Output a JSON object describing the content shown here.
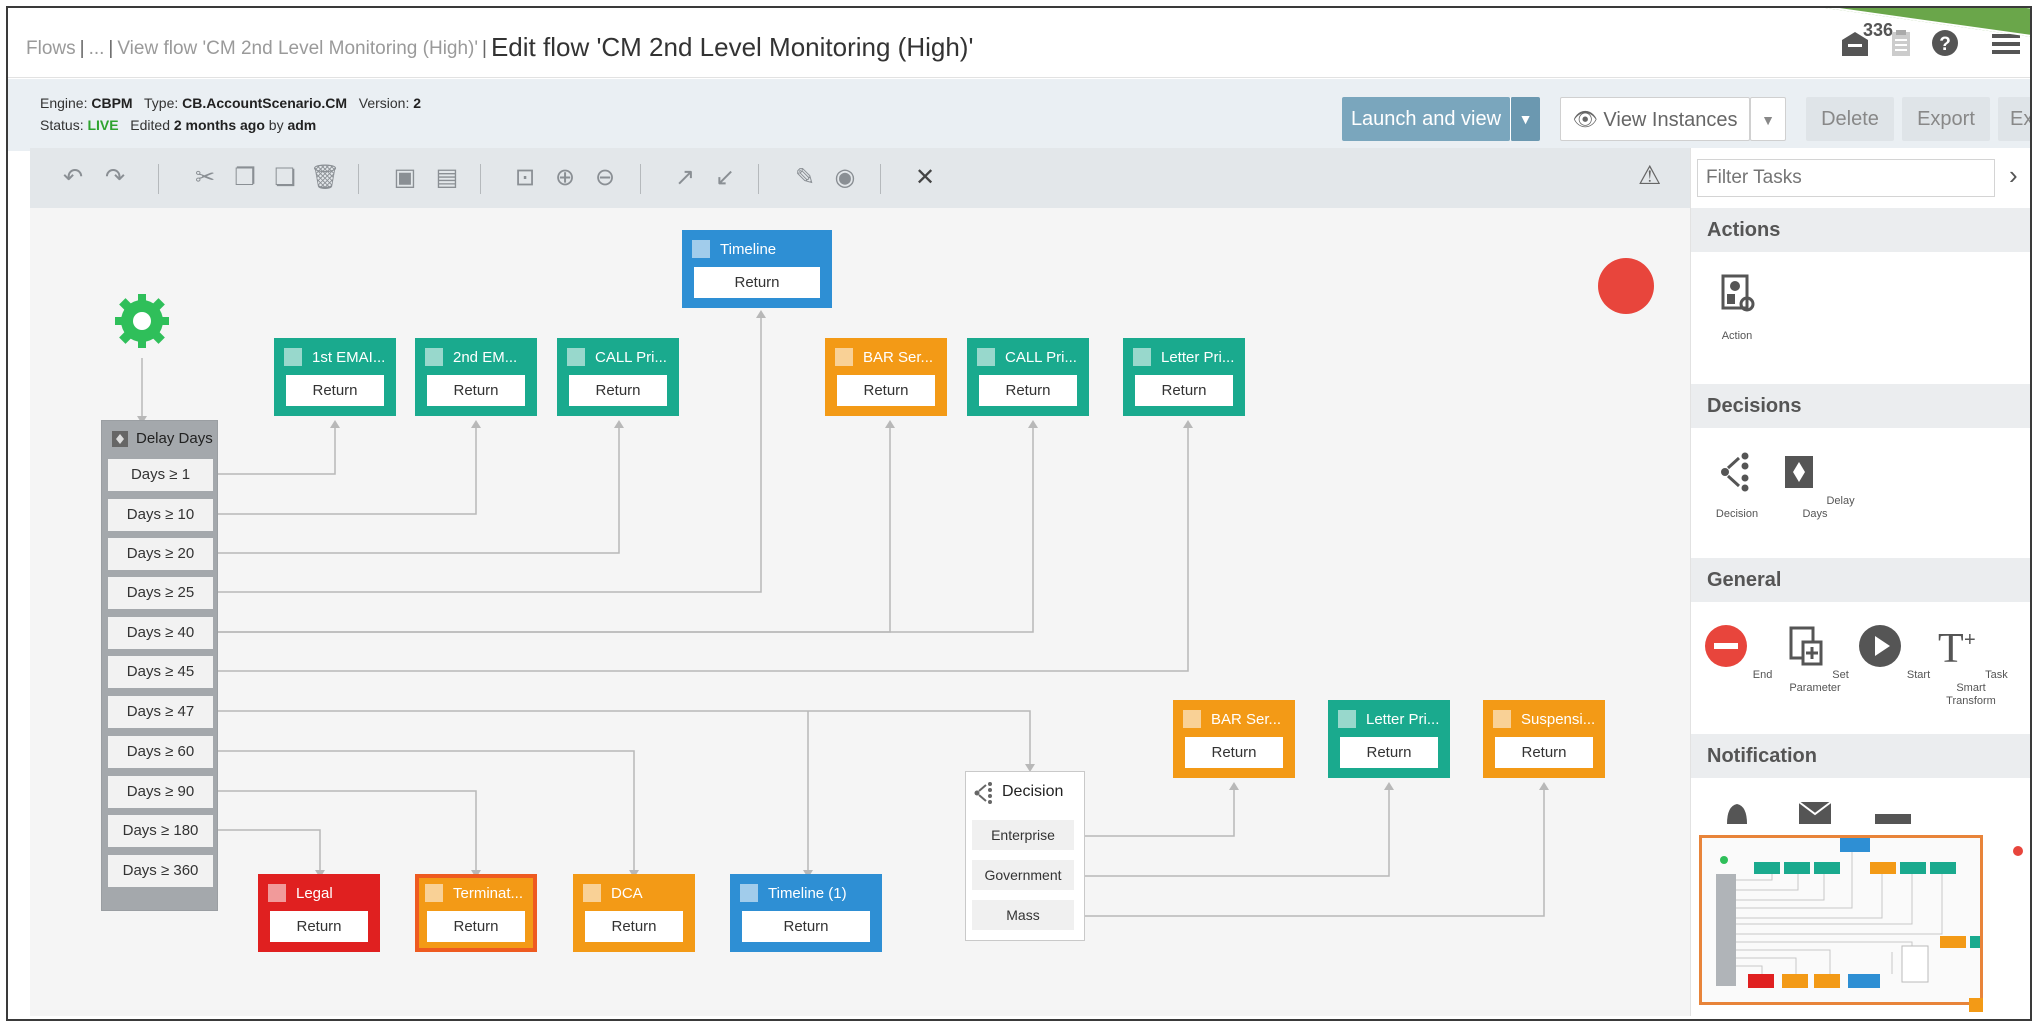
{
  "breadcrumb": {
    "flows": "Flows",
    "ellipsis": "...",
    "view_flow": "View flow 'CM 2nd Level Monitoring (High)'",
    "current": "Edit flow 'CM 2nd Level Monitoring (High)'"
  },
  "header": {
    "notification_count": "336"
  },
  "info": {
    "engine_label": "Engine:",
    "engine": "CBPM",
    "type_label": "Type:",
    "type": "CB.AccountScenario.CM",
    "version_label": "Version:",
    "version": "2",
    "status_label": "Status:",
    "status": "LIVE",
    "edited_label": "Edited",
    "edited_when": "2 months ago",
    "by_label": "by",
    "edited_by": "adm"
  },
  "actions": {
    "launch": "Launch and view",
    "view_instances": "View Instances",
    "delete": "Delete",
    "export": "Export",
    "exit": "Exi"
  },
  "palette": {
    "filter_placeholder": "Filter Tasks",
    "sections": {
      "actions": "Actions",
      "decisions": "Decisions",
      "general": "General",
      "notification": "Notification"
    },
    "items": {
      "action": "Action",
      "decision": "Decision",
      "delay_days": "Delay Days",
      "end": "End",
      "set_parameter": "Set Parameter",
      "start": "Start",
      "task_smart_transform": "Task Smart Transform"
    }
  },
  "flow": {
    "return_label": "Return",
    "nodes": {
      "timeline": "Timeline",
      "email1": "1st EMAI...",
      "email2": "2nd EM...",
      "call1": "CALL Pri...",
      "bar1": "BAR Ser...",
      "call2": "CALL Pri...",
      "letter1": "Letter Pri...",
      "bar2": "BAR Ser...",
      "letter2": "Letter Pri...",
      "suspension": "Suspensi...",
      "legal": "Legal",
      "termination": "Terminat...",
      "dca": "DCA",
      "timeline1": "Timeline (1)"
    },
    "delay": {
      "title": "Delay Days",
      "rows": [
        "Days ≥ 1",
        "Days ≥ 10",
        "Days ≥ 20",
        "Days ≥ 25",
        "Days ≥ 40",
        "Days ≥ 45",
        "Days ≥ 47",
        "Days ≥ 60",
        "Days ≥ 90",
        "Days ≥ 180",
        "Days ≥ 360"
      ]
    },
    "decision": {
      "title": "Decision",
      "rows": [
        "Enterprise",
        "Government",
        "Mass"
      ]
    }
  },
  "colors": {
    "teal": "#1aaa8e",
    "orange": "#f39a16",
    "blue": "#2e8fd4",
    "red": "#e02020",
    "live": "#2ea32e",
    "launch": "#7aa6bd"
  }
}
